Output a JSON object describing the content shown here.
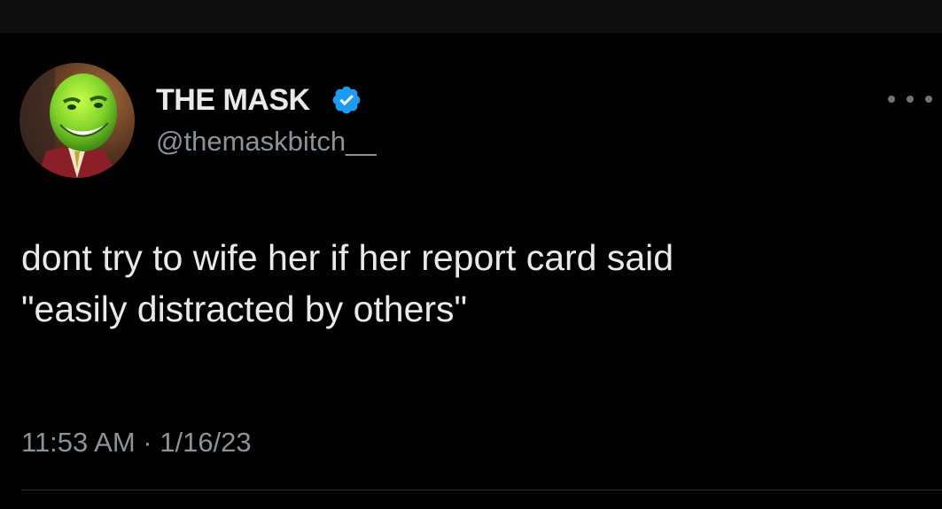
{
  "tweet": {
    "author": {
      "display_name": "THE MASK",
      "handle": "@themaskbitch__",
      "verified": true,
      "verified_icon": "verified-badge-icon",
      "avatar_icon": "avatar-image"
    },
    "text": "dont try to wife her if her report card said\n\"easily distracted by others\"",
    "timestamp": "11:53 AM · 1/16/23",
    "more_icon": "more-options-icon"
  },
  "colors": {
    "background": "#000000",
    "primary_text": "#e7e9ea",
    "secondary_text": "#8b9298",
    "verified_blue": "#1d9bf0",
    "divider": "#2f3336"
  }
}
